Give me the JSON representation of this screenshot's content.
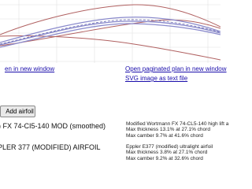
{
  "links": {
    "new_window": "en in new window",
    "paginated_plan": "Open paginated plan in new window",
    "svg_text": "SVG image as text file"
  },
  "add_airfoil_button": "Add airfoil",
  "airfoils": [
    {
      "name": ") FX 74-CI5-140 MOD (smoothed)",
      "details": [
        "Modified Wortmann FX 74-CL5-140 high lift a",
        "Max thickness 13.1% at 27.1% chord",
        "Max camber 9.7% at 41.6% chord"
      ]
    },
    {
      "name": "PLER 377 (MODIFIED) AIRFOIL",
      "details": [
        "Eppler E377 (modified) ultralight airfoil",
        "Max thickness 3.8% at 27.1% chord",
        "Max camber 9.2% at 32.6% chord"
      ]
    }
  ],
  "colors": {
    "grid": "#e0e0e0",
    "airfoil_1": "#8a8acc",
    "airfoil_2": "#b06060",
    "camber_line": "#6a6ab0",
    "link": "#1a0dab"
  }
}
